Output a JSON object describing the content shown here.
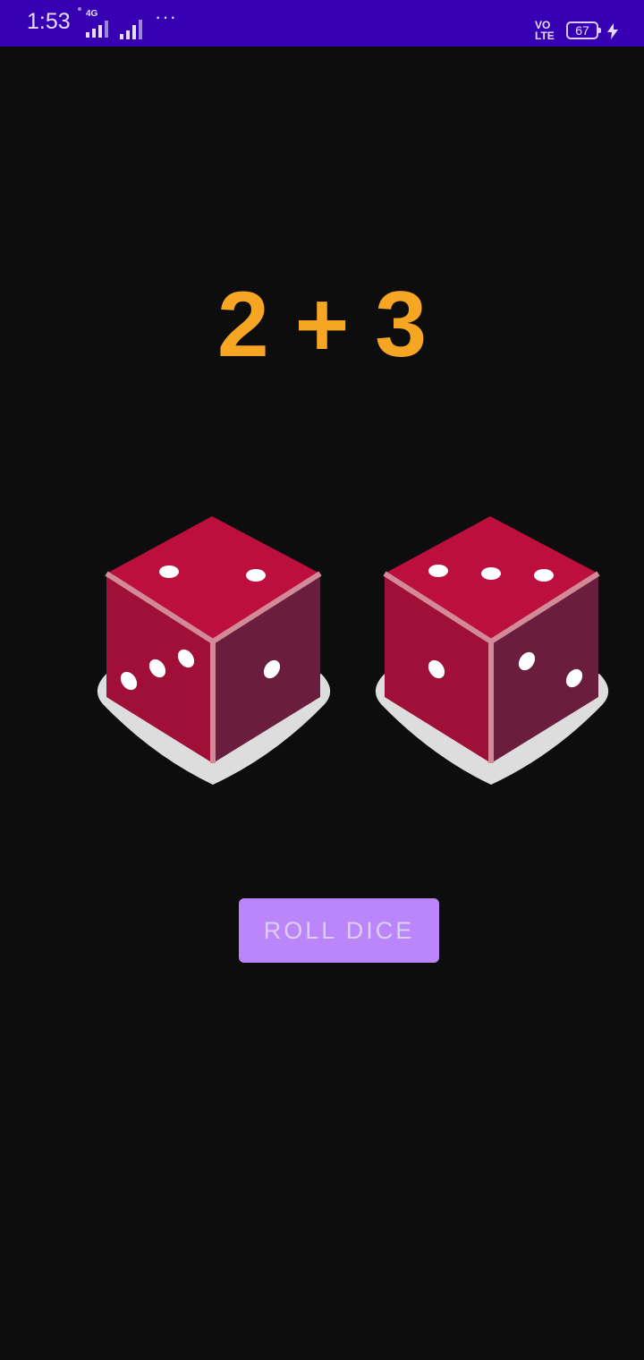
{
  "status_bar": {
    "time": "1:53",
    "network_label": "4G",
    "volte_line1": "VO",
    "volte_line2": "LTE",
    "battery_level": "67",
    "icons": [
      "signal-4g-icon",
      "signal-bars-icon",
      "more-notifications-icon",
      "volte-icon",
      "battery-icon",
      "charging-icon"
    ],
    "background_color": "#3700b3"
  },
  "result": {
    "die1": "2",
    "operator": "+",
    "die2": "3",
    "text": "2 + 3",
    "color": "#f6a623"
  },
  "dice": [
    {
      "name": "die-left",
      "top_pips": 2,
      "left_face_pips": 3,
      "right_face_pips": 1
    },
    {
      "name": "die-right",
      "top_pips": 3,
      "left_face_pips": 1,
      "right_face_pips": 2
    }
  ],
  "roll_button": {
    "label": "ROLL DICE",
    "color": "#bb86fc"
  },
  "colors": {
    "background": "#0d0d0d",
    "die_top": "#bd0f3e",
    "die_left": "#9f0f38",
    "die_right": "#6b1d3e",
    "die_edge": "#d38a98",
    "shadow": "#dddddd"
  }
}
